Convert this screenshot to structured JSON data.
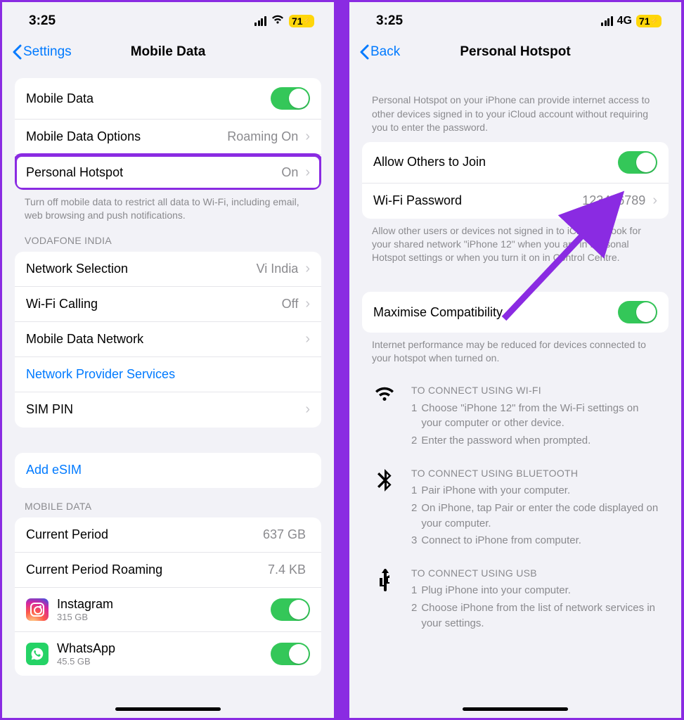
{
  "left": {
    "status": {
      "time": "3:25",
      "battery": "71"
    },
    "nav": {
      "back": "Settings",
      "title": "Mobile Data"
    },
    "g1": {
      "mobile_data": "Mobile Data",
      "options": {
        "label": "Mobile Data Options",
        "value": "Roaming On"
      },
      "hotspot": {
        "label": "Personal Hotspot",
        "value": "On"
      },
      "footer": "Turn off mobile data to restrict all data to Wi-Fi, including email, web browsing and push notifications."
    },
    "carrier": {
      "header": "VODAFONE INDIA",
      "network_selection": {
        "label": "Network Selection",
        "value": "Vi India"
      },
      "wifi_calling": {
        "label": "Wi-Fi Calling",
        "value": "Off"
      },
      "mdn": "Mobile Data Network",
      "nps": "Network Provider Services",
      "sim_pin": "SIM PIN"
    },
    "esim": "Add eSIM",
    "usage": {
      "header": "MOBILE DATA",
      "current_period": {
        "label": "Current Period",
        "value": "637 GB"
      },
      "roaming": {
        "label": "Current Period Roaming",
        "value": "7.4 KB"
      },
      "apps": [
        {
          "name": "Instagram",
          "size": "315 GB",
          "kind": "ig"
        },
        {
          "name": "WhatsApp",
          "size": "45.5 GB",
          "kind": "wa"
        }
      ]
    }
  },
  "right": {
    "status": {
      "time": "3:25",
      "net": "4G",
      "battery": "71"
    },
    "nav": {
      "back": "Back",
      "title": "Personal Hotspot"
    },
    "intro": "Personal Hotspot on your iPhone can provide internet access to other devices signed in to your iCloud account without requiring you to enter the password.",
    "allow": "Allow Others to Join",
    "pw": {
      "label": "Wi-Fi Password",
      "value": "123456789"
    },
    "allow_footer": "Allow other users or devices not signed in to iCloud to look for your shared network \"iPhone 12\" when you are in Personal Hotspot settings or when you turn it on in Control Centre.",
    "compat": "Maximise Compatibility",
    "compat_footer": "Internet performance may be reduced for devices connected to your hotspot when turned on.",
    "wifi": {
      "title": "TO CONNECT USING WI-FI",
      "s1": "Choose \"iPhone 12\" from the Wi-Fi settings on your computer or other device.",
      "s2": "Enter the password when prompted."
    },
    "bt": {
      "title": "TO CONNECT USING BLUETOOTH",
      "s1": "Pair iPhone with your computer.",
      "s2": "On iPhone, tap Pair or enter the code displayed on your computer.",
      "s3": "Connect to iPhone from computer."
    },
    "usb": {
      "title": "TO CONNECT USING USB",
      "s1": "Plug iPhone into your computer.",
      "s2": "Choose iPhone from the list of network services in your settings."
    }
  }
}
